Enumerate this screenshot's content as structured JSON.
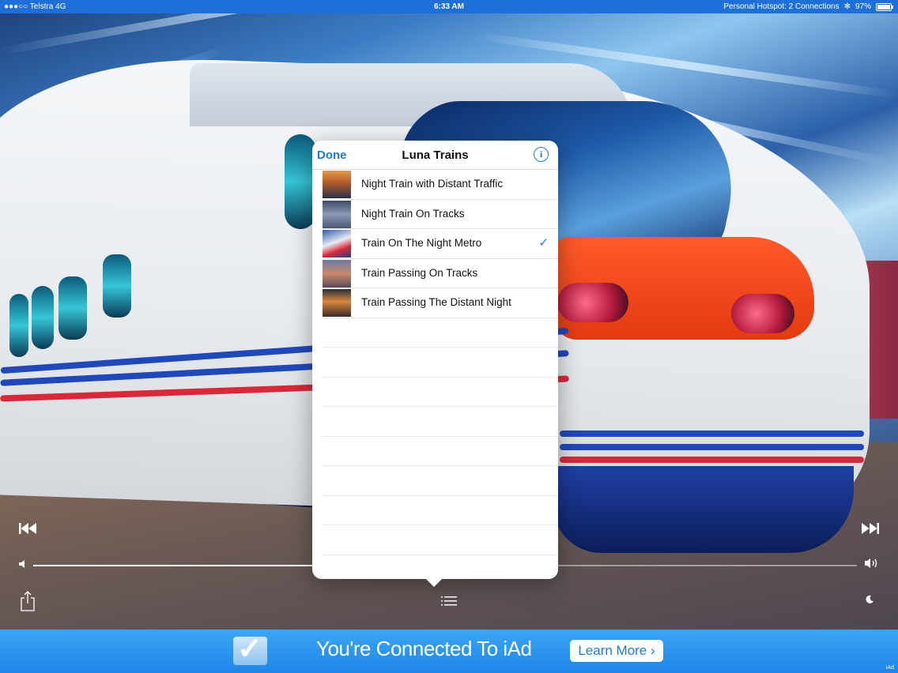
{
  "status_bar": {
    "carrier": "●●●○○ Telstra  4G",
    "time": "6:33 AM",
    "hotspot": "Personal Hotspot: 2 Connections",
    "bluetooth": "✻",
    "battery_percent": "97%",
    "battery_level": 0.97
  },
  "player": {
    "prev_icon": "previous-track-icon",
    "next_icon": "next-track-icon",
    "volume_level": 0.34,
    "share_icon": "share-icon",
    "playlist_icon": "list-icon",
    "sleep_icon": "moon-icon"
  },
  "popover": {
    "done_label": "Done",
    "title": "Luna Trains",
    "info_label": "i",
    "items": [
      {
        "label": "Night Train with Distant Traffic",
        "selected": false
      },
      {
        "label": "Night Train On Tracks",
        "selected": false
      },
      {
        "label": "Train On The Night Metro",
        "selected": true
      },
      {
        "label": "Train Passing On Tracks",
        "selected": false
      },
      {
        "label": "Train Passing The Distant Night",
        "selected": false
      }
    ],
    "check_glyph": "✓"
  },
  "ad": {
    "text": "You're Connected To iAd",
    "button_label": "Learn More ›",
    "corner_label": "iAd"
  },
  "colors": {
    "accent": "#1f7ad6",
    "status_bar": "#1f6fd8",
    "ad_banner": "#2b96ef"
  }
}
